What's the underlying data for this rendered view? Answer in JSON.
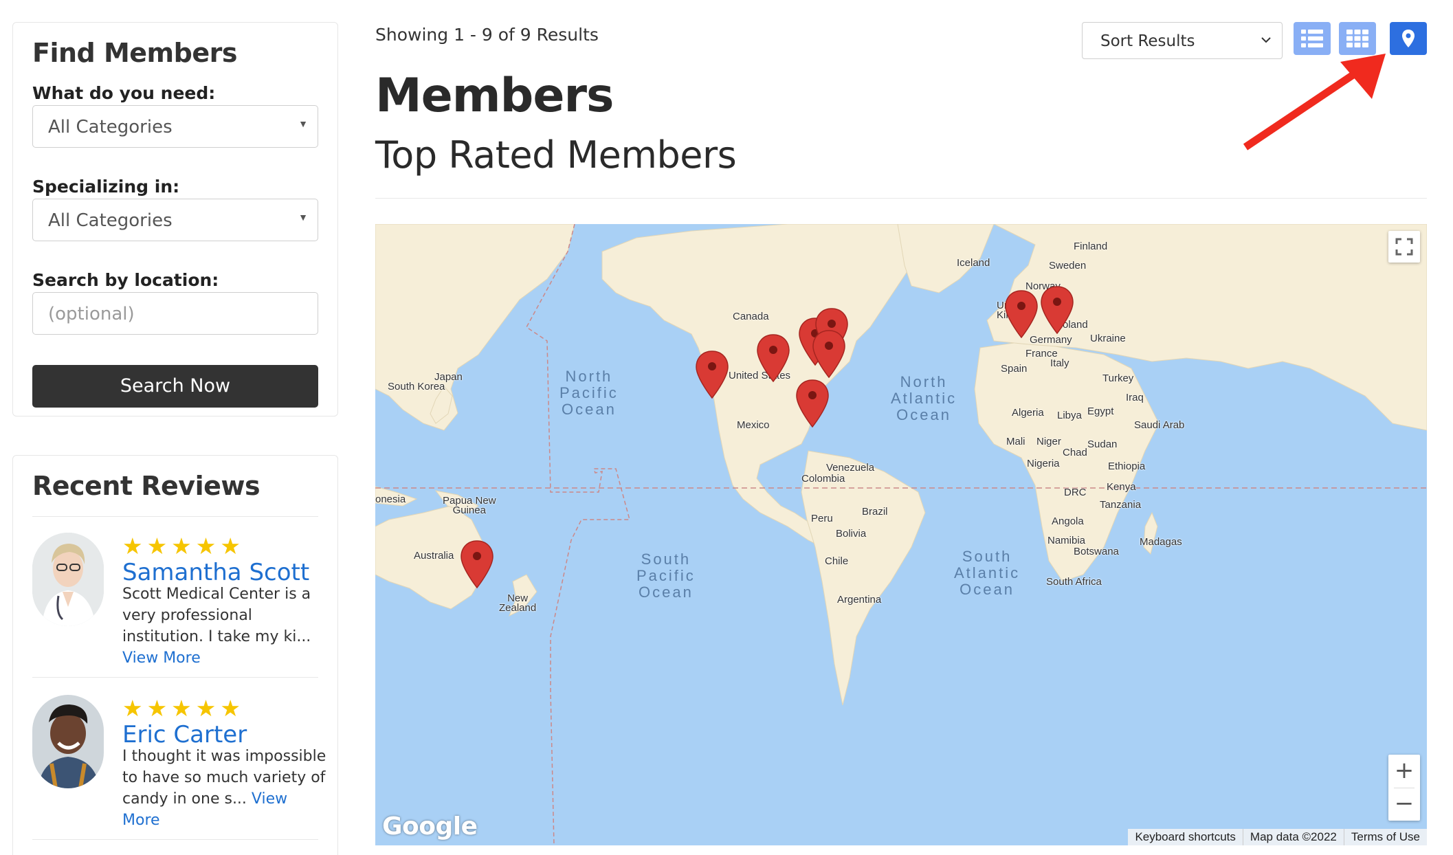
{
  "sidebar": {
    "find_title": "Find Members",
    "need_label": "What do you need:",
    "need_value": "All Categories",
    "specializing_label": "Specializing in:",
    "specializing_value": "All Categories",
    "location_label": "Search by location:",
    "location_placeholder": "(optional)",
    "search_button": "Search Now",
    "reviews_title": "Recent Reviews",
    "reviews": [
      {
        "stars": "★★★★★",
        "name": "Samantha Scott",
        "text": "Scott Medical Center is a very professional institution. I take my ki...",
        "more": "View More"
      },
      {
        "stars": "★★★★★",
        "name": "Eric Carter",
        "text": "I thought it was impossible to have so much variety of candy in one s...",
        "more": "View More"
      }
    ]
  },
  "main": {
    "showing": "Showing 1 - 9 of 9 Results",
    "title": "Members",
    "subtitle": "Top Rated Members",
    "sort_value": "Sort Results",
    "view_buttons": [
      "list-view",
      "grid-view",
      "map-view"
    ],
    "active_view": "map-view"
  },
  "map": {
    "countries": {
      "finland": "Finland",
      "iceland": "Iceland",
      "sweden": "Sweden",
      "norway": "Norway",
      "uk": "Uni\nKingd",
      "poland": "Poland",
      "germany": "Germany",
      "ukraine": "Ukraine",
      "france": "France",
      "italy": "Italy",
      "spain": "Spain",
      "turkey": "Turkey",
      "iraq": "Iraq",
      "algeria": "Algeria",
      "libya": "Libya",
      "egypt": "Egypt",
      "saudi": "Saudi Arab",
      "mali": "Mali",
      "niger": "Niger",
      "sudan": "Sudan",
      "chad": "Chad",
      "nigeria": "Nigeria",
      "ethiopia": "Ethiopia",
      "kenya": "Kenya",
      "drc": "DRC",
      "tanzania": "Tanzania",
      "angola": "Angola",
      "namibia": "Namibia",
      "botswana": "Botswana",
      "madagascar": "Madagas",
      "south_africa": "South Africa",
      "canada": "Canada",
      "united_states": "United States",
      "mexico": "Mexico",
      "venezuela": "Venezuela",
      "colombia": "Colombia",
      "peru": "Peru",
      "brazil": "Brazil",
      "bolivia": "Bolivia",
      "chile": "Chile",
      "argentina": "Argentina",
      "japan": "Japan",
      "south_korea": "South Korea",
      "indonesia": "onesia",
      "papua": "Papua New\nGuinea",
      "australia": "Australia",
      "new_zealand": "New\nZealand"
    },
    "oceans": {
      "north_pacific": "North\nPacific\nOcean",
      "north_atlantic": "North\nAtlantic\nOcean",
      "south_pacific": "South\nPacific\nOcean",
      "south_atlantic": "South\nAtlantic\nOcean"
    },
    "footer": {
      "shortcuts": "Keyboard shortcuts",
      "map_data": "Map data ©2022",
      "terms": "Terms of Use"
    },
    "logo": "Google",
    "zoom_in": "+",
    "zoom_out": "−",
    "marker_count": 9,
    "colors": {
      "water": "#a9d0f5",
      "land": "#f6eed8",
      "marker": "#d93a34",
      "active_button": "#2d6fe0",
      "inactive_button": "#89aff5",
      "link": "#1e6fd0",
      "stars": "#f6c500",
      "arrow": "#f02a1e"
    }
  }
}
